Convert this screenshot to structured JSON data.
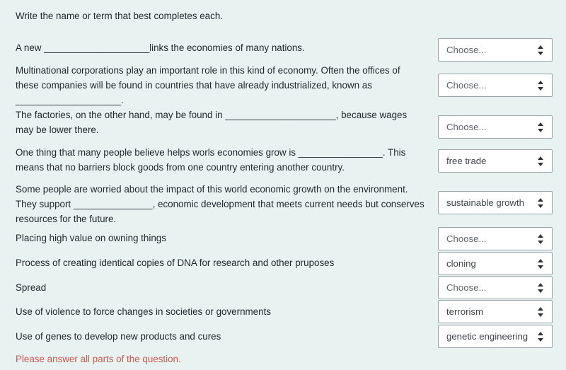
{
  "page": {
    "background_color": "#e8f2f1",
    "instruction": "Write the name or term that best completes each."
  },
  "questions": [
    {
      "id": "q1",
      "text": "A new ____________________links the economies of many nations.",
      "select": {
        "value": "Choose...",
        "is_placeholder": true
      }
    },
    {
      "id": "q2",
      "text": "Multinational corporations play an important role in this kind of economy.  Often the offices of these companies will be found in countries that have already industrialized, known as ____________________.",
      "select": {
        "value": "Choose...",
        "is_placeholder": true
      }
    },
    {
      "id": "q3",
      "text": "The factories, on the other hand, may be found in _____________________, because wages may be lower there.",
      "select": {
        "value": "Choose...",
        "is_placeholder": true
      }
    },
    {
      "id": "q4",
      "text": "One thing that many people believe helps worls economies grow is ________________.  This means that no barriers block goods from one country entering another country.",
      "select": {
        "value": "free trade",
        "is_placeholder": false
      }
    },
    {
      "id": "q5",
      "text": "Some people are worried about the impact of this world economic growth on the environment. They support _______________, economic development that meets current needs but conserves resources for the future.",
      "select": {
        "value": "sustainable growth",
        "is_placeholder": false
      }
    },
    {
      "id": "q6",
      "text": "Placing high value on owning things",
      "select": {
        "value": "Choose...",
        "is_placeholder": true
      }
    },
    {
      "id": "q7",
      "text": "Process of creating identical copies of DNA for research and other pruposes",
      "select": {
        "value": "cloning",
        "is_placeholder": false
      }
    },
    {
      "id": "q8",
      "text": "Spread",
      "select": {
        "value": "Choose...",
        "is_placeholder": true
      }
    },
    {
      "id": "q9",
      "text": "Use of violence to force changes in societies or governments",
      "select": {
        "value": "terrorism",
        "is_placeholder": false
      }
    },
    {
      "id": "q10",
      "text": "Use of genes to develop new products and cures",
      "select": {
        "value": "genetic engineering",
        "is_placeholder": false
      }
    }
  ],
  "validation": {
    "message": "Please answer all parts of the question.",
    "color": "#c9584c"
  }
}
